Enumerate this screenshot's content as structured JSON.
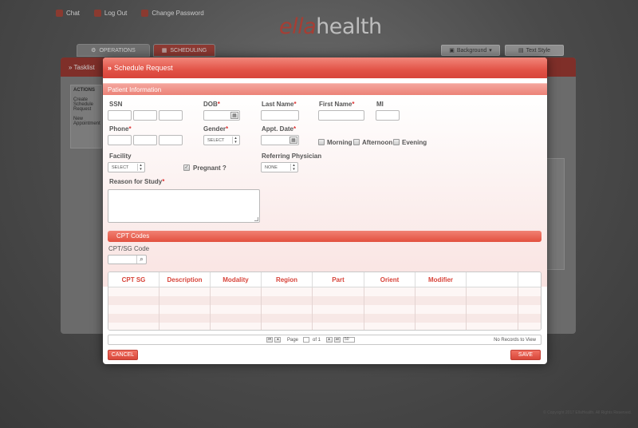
{
  "top_links": [
    {
      "label": "Chat",
      "icon": "chat-icon"
    },
    {
      "label": "Log Out",
      "icon": "logout-icon"
    },
    {
      "label": "Change Password",
      "icon": "key-icon"
    }
  ],
  "logo": {
    "part1": "ella",
    "part2": "health"
  },
  "main_tabs": [
    {
      "label": "OPERATIONS",
      "icon": "gear-icon"
    },
    {
      "label": "SCHEDULING",
      "icon": "calendar-icon"
    }
  ],
  "right_buttons": [
    {
      "label": "Background",
      "icon": "image-icon"
    },
    {
      "label": "Text Style",
      "icon": "text-icon"
    }
  ],
  "bg_panel": {
    "title": "Tasklist",
    "actions_title": "ACTIONS",
    "actions": [
      "Create Schedule Request",
      "New Appointment"
    ]
  },
  "footer": "© Copyright 2017 EllaHealth. All Rights Reserved.",
  "modal": {
    "title": "Schedule Request",
    "section_title": "Patient Information",
    "labels": {
      "ssn": "SSN",
      "dob": "DOB",
      "last_name": "Last Name",
      "first_name": "First Name",
      "mi": "MI",
      "phone": "Phone",
      "gender": "Gender",
      "appt_date": "Appt. Date",
      "facility": "Facility",
      "referring_physician": "Referring Physician",
      "reason": "Reason for Study",
      "pregnant": "Pregnant ?"
    },
    "required_mark": "*",
    "gender_select": "SELECT",
    "facility_select": "SELECT",
    "physician_select": "NONE",
    "time_options": [
      "Morning",
      "Afternoon",
      "Evening"
    ],
    "cpt_section": "CPT Codes",
    "cpt_search_label": "CPT/SG Code",
    "grid_columns": [
      "CPT SG",
      "Description",
      "Modality",
      "Region",
      "Part",
      "Orient",
      "Modifier",
      "",
      ""
    ],
    "pager": {
      "page_label": "Page",
      "page_value": "1",
      "of_label": "of 1",
      "page_size": "50",
      "records": "No Records to View"
    },
    "cancel_label": "CANCEL",
    "save_label": "SAVE"
  }
}
